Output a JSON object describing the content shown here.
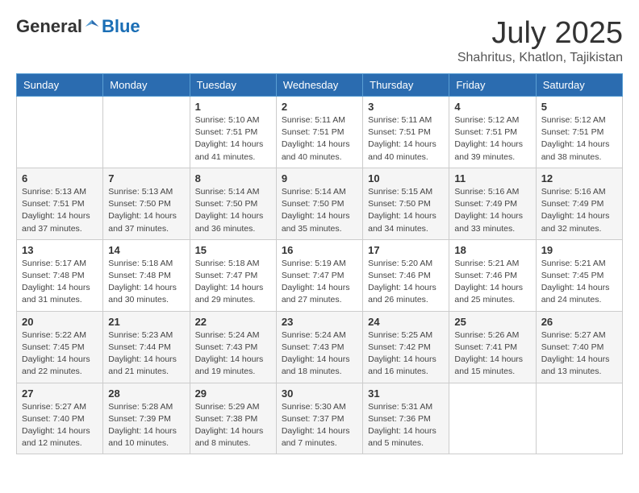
{
  "header": {
    "logo": {
      "part1": "General",
      "part2": "Blue"
    },
    "title": "July 2025",
    "location": "Shahritus, Khatlon, Tajikistan"
  },
  "weekdays": [
    "Sunday",
    "Monday",
    "Tuesday",
    "Wednesday",
    "Thursday",
    "Friday",
    "Saturday"
  ],
  "weeks": [
    [
      {
        "day": "",
        "sunrise": "",
        "sunset": "",
        "daylight": ""
      },
      {
        "day": "",
        "sunrise": "",
        "sunset": "",
        "daylight": ""
      },
      {
        "day": "1",
        "sunrise": "Sunrise: 5:10 AM",
        "sunset": "Sunset: 7:51 PM",
        "daylight": "Daylight: 14 hours and 41 minutes."
      },
      {
        "day": "2",
        "sunrise": "Sunrise: 5:11 AM",
        "sunset": "Sunset: 7:51 PM",
        "daylight": "Daylight: 14 hours and 40 minutes."
      },
      {
        "day": "3",
        "sunrise": "Sunrise: 5:11 AM",
        "sunset": "Sunset: 7:51 PM",
        "daylight": "Daylight: 14 hours and 40 minutes."
      },
      {
        "day": "4",
        "sunrise": "Sunrise: 5:12 AM",
        "sunset": "Sunset: 7:51 PM",
        "daylight": "Daylight: 14 hours and 39 minutes."
      },
      {
        "day": "5",
        "sunrise": "Sunrise: 5:12 AM",
        "sunset": "Sunset: 7:51 PM",
        "daylight": "Daylight: 14 hours and 38 minutes."
      }
    ],
    [
      {
        "day": "6",
        "sunrise": "Sunrise: 5:13 AM",
        "sunset": "Sunset: 7:51 PM",
        "daylight": "Daylight: 14 hours and 37 minutes."
      },
      {
        "day": "7",
        "sunrise": "Sunrise: 5:13 AM",
        "sunset": "Sunset: 7:50 PM",
        "daylight": "Daylight: 14 hours and 37 minutes."
      },
      {
        "day": "8",
        "sunrise": "Sunrise: 5:14 AM",
        "sunset": "Sunset: 7:50 PM",
        "daylight": "Daylight: 14 hours and 36 minutes."
      },
      {
        "day": "9",
        "sunrise": "Sunrise: 5:14 AM",
        "sunset": "Sunset: 7:50 PM",
        "daylight": "Daylight: 14 hours and 35 minutes."
      },
      {
        "day": "10",
        "sunrise": "Sunrise: 5:15 AM",
        "sunset": "Sunset: 7:50 PM",
        "daylight": "Daylight: 14 hours and 34 minutes."
      },
      {
        "day": "11",
        "sunrise": "Sunrise: 5:16 AM",
        "sunset": "Sunset: 7:49 PM",
        "daylight": "Daylight: 14 hours and 33 minutes."
      },
      {
        "day": "12",
        "sunrise": "Sunrise: 5:16 AM",
        "sunset": "Sunset: 7:49 PM",
        "daylight": "Daylight: 14 hours and 32 minutes."
      }
    ],
    [
      {
        "day": "13",
        "sunrise": "Sunrise: 5:17 AM",
        "sunset": "Sunset: 7:48 PM",
        "daylight": "Daylight: 14 hours and 31 minutes."
      },
      {
        "day": "14",
        "sunrise": "Sunrise: 5:18 AM",
        "sunset": "Sunset: 7:48 PM",
        "daylight": "Daylight: 14 hours and 30 minutes."
      },
      {
        "day": "15",
        "sunrise": "Sunrise: 5:18 AM",
        "sunset": "Sunset: 7:47 PM",
        "daylight": "Daylight: 14 hours and 29 minutes."
      },
      {
        "day": "16",
        "sunrise": "Sunrise: 5:19 AM",
        "sunset": "Sunset: 7:47 PM",
        "daylight": "Daylight: 14 hours and 27 minutes."
      },
      {
        "day": "17",
        "sunrise": "Sunrise: 5:20 AM",
        "sunset": "Sunset: 7:46 PM",
        "daylight": "Daylight: 14 hours and 26 minutes."
      },
      {
        "day": "18",
        "sunrise": "Sunrise: 5:21 AM",
        "sunset": "Sunset: 7:46 PM",
        "daylight": "Daylight: 14 hours and 25 minutes."
      },
      {
        "day": "19",
        "sunrise": "Sunrise: 5:21 AM",
        "sunset": "Sunset: 7:45 PM",
        "daylight": "Daylight: 14 hours and 24 minutes."
      }
    ],
    [
      {
        "day": "20",
        "sunrise": "Sunrise: 5:22 AM",
        "sunset": "Sunset: 7:45 PM",
        "daylight": "Daylight: 14 hours and 22 minutes."
      },
      {
        "day": "21",
        "sunrise": "Sunrise: 5:23 AM",
        "sunset": "Sunset: 7:44 PM",
        "daylight": "Daylight: 14 hours and 21 minutes."
      },
      {
        "day": "22",
        "sunrise": "Sunrise: 5:24 AM",
        "sunset": "Sunset: 7:43 PM",
        "daylight": "Daylight: 14 hours and 19 minutes."
      },
      {
        "day": "23",
        "sunrise": "Sunrise: 5:24 AM",
        "sunset": "Sunset: 7:43 PM",
        "daylight": "Daylight: 14 hours and 18 minutes."
      },
      {
        "day": "24",
        "sunrise": "Sunrise: 5:25 AM",
        "sunset": "Sunset: 7:42 PM",
        "daylight": "Daylight: 14 hours and 16 minutes."
      },
      {
        "day": "25",
        "sunrise": "Sunrise: 5:26 AM",
        "sunset": "Sunset: 7:41 PM",
        "daylight": "Daylight: 14 hours and 15 minutes."
      },
      {
        "day": "26",
        "sunrise": "Sunrise: 5:27 AM",
        "sunset": "Sunset: 7:40 PM",
        "daylight": "Daylight: 14 hours and 13 minutes."
      }
    ],
    [
      {
        "day": "27",
        "sunrise": "Sunrise: 5:27 AM",
        "sunset": "Sunset: 7:40 PM",
        "daylight": "Daylight: 14 hours and 12 minutes."
      },
      {
        "day": "28",
        "sunrise": "Sunrise: 5:28 AM",
        "sunset": "Sunset: 7:39 PM",
        "daylight": "Daylight: 14 hours and 10 minutes."
      },
      {
        "day": "29",
        "sunrise": "Sunrise: 5:29 AM",
        "sunset": "Sunset: 7:38 PM",
        "daylight": "Daylight: 14 hours and 8 minutes."
      },
      {
        "day": "30",
        "sunrise": "Sunrise: 5:30 AM",
        "sunset": "Sunset: 7:37 PM",
        "daylight": "Daylight: 14 hours and 7 minutes."
      },
      {
        "day": "31",
        "sunrise": "Sunrise: 5:31 AM",
        "sunset": "Sunset: 7:36 PM",
        "daylight": "Daylight: 14 hours and 5 minutes."
      },
      {
        "day": "",
        "sunrise": "",
        "sunset": "",
        "daylight": ""
      },
      {
        "day": "",
        "sunrise": "",
        "sunset": "",
        "daylight": ""
      }
    ]
  ]
}
